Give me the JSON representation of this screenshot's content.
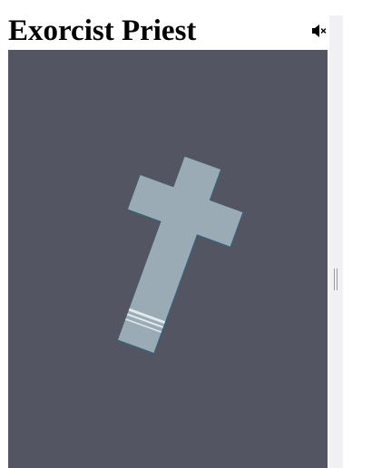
{
  "game": {
    "title": "Exorcist Priest",
    "sound": {
      "muted": true,
      "icon": "speaker-muted-icon"
    },
    "scene": {
      "background": "#545562",
      "object": "cross-icon",
      "cross_color": "#9aabb5",
      "cross_shadow": "#3d5f74",
      "band_color": "#e2eaee"
    }
  }
}
